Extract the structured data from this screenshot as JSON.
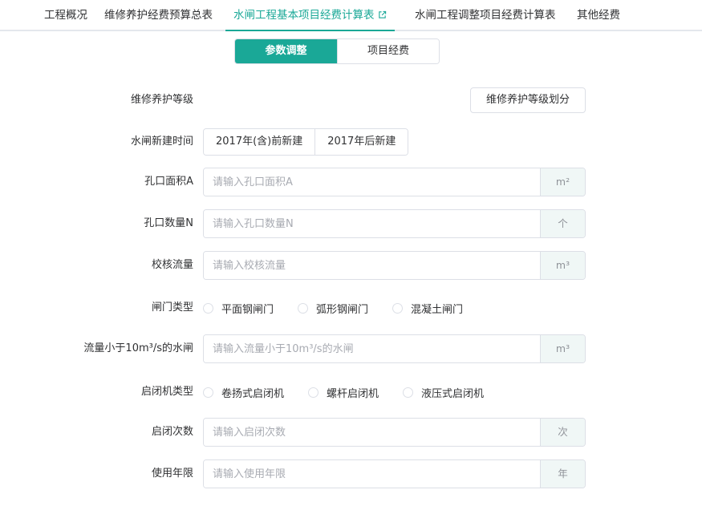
{
  "tabs": [
    {
      "label": "工程概况"
    },
    {
      "label": "维修养护经费预算总表"
    },
    {
      "label": "水闸工程基本项目经费计算表"
    },
    {
      "label": "水闸工程调整项目经费计算表"
    },
    {
      "label": "其他经费"
    }
  ],
  "active_tab_icon": "external-link-icon",
  "segment": {
    "params": "参数调整",
    "costs": "项目经费"
  },
  "form": {
    "grade": {
      "label": "维修养护等级",
      "button": "维修养护等级划分"
    },
    "build_time": {
      "label": "水闸新建时间",
      "options": [
        "2017年(含)前新建",
        "2017年后新建"
      ]
    },
    "hole_area": {
      "label": "孔口面积A",
      "placeholder": "请输入孔口面积A",
      "unit": "m²"
    },
    "hole_count": {
      "label": "孔口数量N",
      "placeholder": "请输入孔口数量N",
      "unit": "个"
    },
    "check_flow": {
      "label": "校核流量",
      "placeholder": "请输入校核流量",
      "unit": "m³"
    },
    "gate_type": {
      "label": "闸门类型",
      "options": [
        "平面钢闸门",
        "弧形钢闸门",
        "混凝土闸门"
      ]
    },
    "small_flow": {
      "label": "流量小于10m³/s的水闸",
      "placeholder": "请输入流量小于10m³/s的水闸",
      "unit": "m³"
    },
    "hoist_type": {
      "label": "启闭机类型",
      "options": [
        "卷扬式启闭机",
        "螺杆启闭机",
        "液压式启闭机"
      ]
    },
    "hoist_times": {
      "label": "启闭次数",
      "placeholder": "请输入启闭次数",
      "unit": "次"
    },
    "service_years": {
      "label": "使用年限",
      "placeholder": "请输入使用年限",
      "unit": "年"
    }
  },
  "colors": {
    "accent": "#1aa897",
    "border": "#dcdfe6",
    "append_bg": "#f0f7f6"
  }
}
